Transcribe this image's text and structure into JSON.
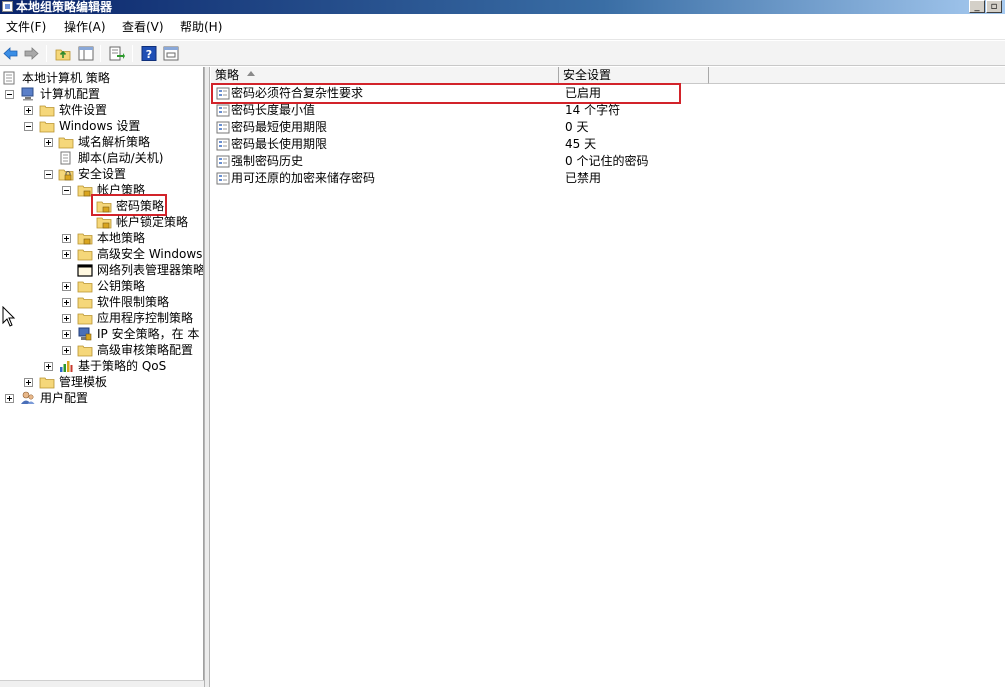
{
  "window": {
    "title": "本地组策略编辑器"
  },
  "menu": [
    "文件(F)",
    "操作(A)",
    "查看(V)",
    "帮助(H)"
  ],
  "toolbar": {
    "icons": [
      "back-arrow-icon",
      "forward-arrow-icon",
      "up-folder-icon",
      "show-hide-tree-icon",
      "export-list-icon",
      "help-icon",
      "properties-icon"
    ]
  },
  "tree": [
    {
      "label": "本地计算机 策略",
      "icon": "policy-document-icon"
    },
    {
      "label": "计算机配置",
      "icon": "computer-icon",
      "expanded": true
    },
    {
      "label": "软件设置",
      "icon": "folder-icon",
      "expanded": false
    },
    {
      "label": "Windows 设置",
      "icon": "folder-icon",
      "expanded": true
    },
    {
      "label": "域名解析策略",
      "icon": "folder-icon",
      "expanded": false
    },
    {
      "label": "脚本(启动/关机)",
      "icon": "script-icon"
    },
    {
      "label": "安全设置",
      "icon": "security-folder-icon",
      "expanded": true
    },
    {
      "label": "帐户策略",
      "icon": "folder-icon",
      "expanded": true
    },
    {
      "label": "密码策略",
      "icon": "folder-icon",
      "selected": true
    },
    {
      "label": "帐户锁定策略",
      "icon": "security-folder-icon"
    },
    {
      "label": "本地策略",
      "icon": "security-folder-icon",
      "expanded": false
    },
    {
      "label": "高级安全 Windows F",
      "icon": "folder-icon",
      "expanded": false
    },
    {
      "label": "网络列表管理器策略",
      "icon": "network-list-icon"
    },
    {
      "label": "公钥策略",
      "icon": "folder-icon",
      "expanded": false
    },
    {
      "label": "软件限制策略",
      "icon": "folder-icon",
      "expanded": false
    },
    {
      "label": "应用程序控制策略",
      "icon": "folder-icon",
      "expanded": false
    },
    {
      "label": "IP 安全策略，在 本",
      "icon": "ip-security-icon",
      "expanded": false
    },
    {
      "label": "高级审核策略配置",
      "icon": "folder-icon",
      "expanded": false
    },
    {
      "label": "基于策略的 QoS",
      "icon": "qos-chart-icon",
      "expanded": false
    },
    {
      "label": "管理模板",
      "icon": "folder-icon",
      "expanded": false
    },
    {
      "label": "用户配置",
      "icon": "user-icon",
      "expanded": false
    }
  ],
  "list": {
    "columns": [
      "策略",
      "安全设置"
    ],
    "rows": [
      {
        "policy": "密码必须符合复杂性要求",
        "setting": "已启用"
      },
      {
        "policy": "密码长度最小值",
        "setting": "14 个字符"
      },
      {
        "policy": "密码最短使用期限",
        "setting": "0 天"
      },
      {
        "policy": "密码最长使用期限",
        "setting": "45 天"
      },
      {
        "policy": "强制密码历史",
        "setting": "0 个记住的密码"
      },
      {
        "policy": "用可还原的加密来储存密码",
        "setting": "已禁用"
      }
    ]
  },
  "colors": {
    "highlight_box": "#d2232a",
    "folder": "#f5d77a"
  }
}
